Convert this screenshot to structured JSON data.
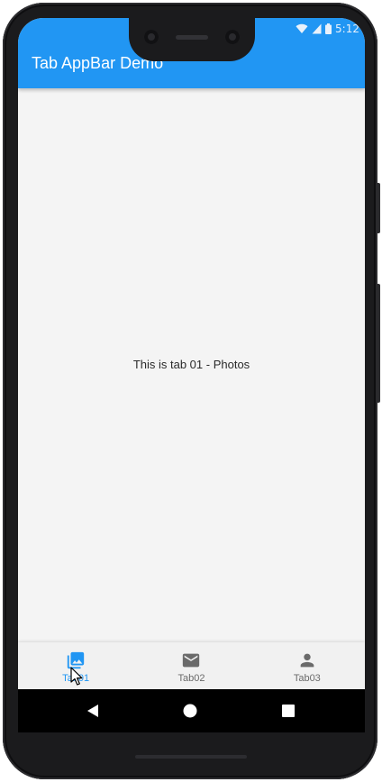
{
  "status_bar": {
    "time": "5:12",
    "icons": [
      "wifi-icon",
      "signal-icon",
      "battery-icon"
    ]
  },
  "app_bar": {
    "title": "Tab AppBar Demo",
    "color": "#2196f3"
  },
  "content": {
    "text": "This is tab 01 - Photos"
  },
  "bottom_nav": {
    "active_color": "#2196f3",
    "inactive_color": "#6a6a6a",
    "items": [
      {
        "label": "Tab01",
        "icon": "photo-library-icon",
        "active": true
      },
      {
        "label": "Tab02",
        "icon": "mail-icon",
        "active": false
      },
      {
        "label": "Tab03",
        "icon": "person-icon",
        "active": false
      }
    ]
  },
  "system_nav": {
    "buttons": [
      "back-icon",
      "home-icon",
      "recents-icon"
    ]
  }
}
